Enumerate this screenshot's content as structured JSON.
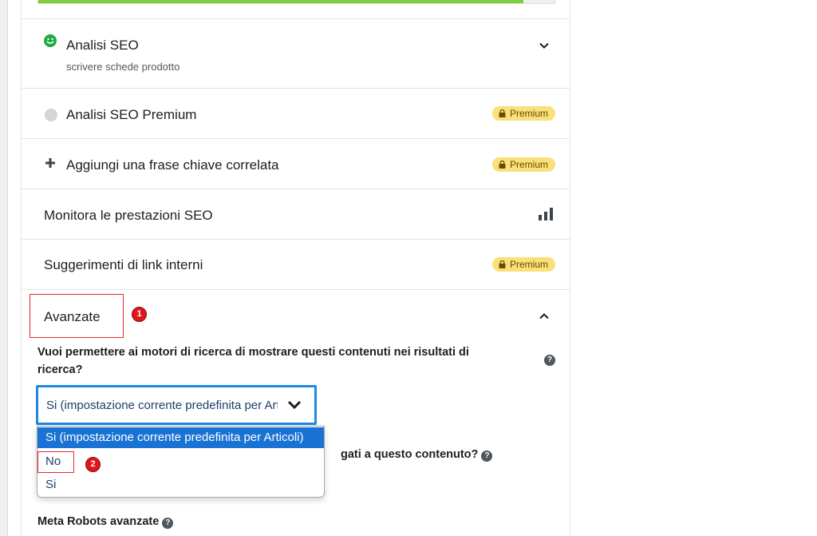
{
  "progress": {
    "fraction": 0.94,
    "color": "#7ad03a"
  },
  "sections": {
    "seo_analysis": {
      "title": "Analisi SEO",
      "subtitle": "scrivere schede prodotto",
      "status_icon": "smiley-icon"
    },
    "seo_premium": {
      "title": "Analisi SEO Premium",
      "badge": "Premium"
    },
    "related_keyphrase": {
      "title": "Aggiungi una frase chiave correlata",
      "badge": "Premium"
    },
    "monitor_seo": {
      "title": "Monitora le prestazioni SEO",
      "icon": "bar-chart-icon"
    },
    "internal_links": {
      "title": "Suggerimenti di link interni",
      "badge": "Premium"
    },
    "advanced": {
      "title": "Avanzate",
      "step": "1"
    }
  },
  "advanced_panel": {
    "question": "Vuoi permettere ai motori di ricerca di mostrare questi contenuti nei risultati di ricerca?",
    "select_value": "Si (impostazione corrente predefinita per Articoli)",
    "options": [
      "Si (impostazione corrente predefinita per Articoli)",
      "No",
      "Si"
    ],
    "option_step": "2",
    "partially_hidden_question": "gati a questo contenuto?",
    "meta_robots_label": "Meta Robots avanzate"
  },
  "colors": {
    "premium_badge": "#f9e07a",
    "select_border": "#1e88e5",
    "highlight": "#e8262b",
    "selected_option": "#1a73d4"
  }
}
